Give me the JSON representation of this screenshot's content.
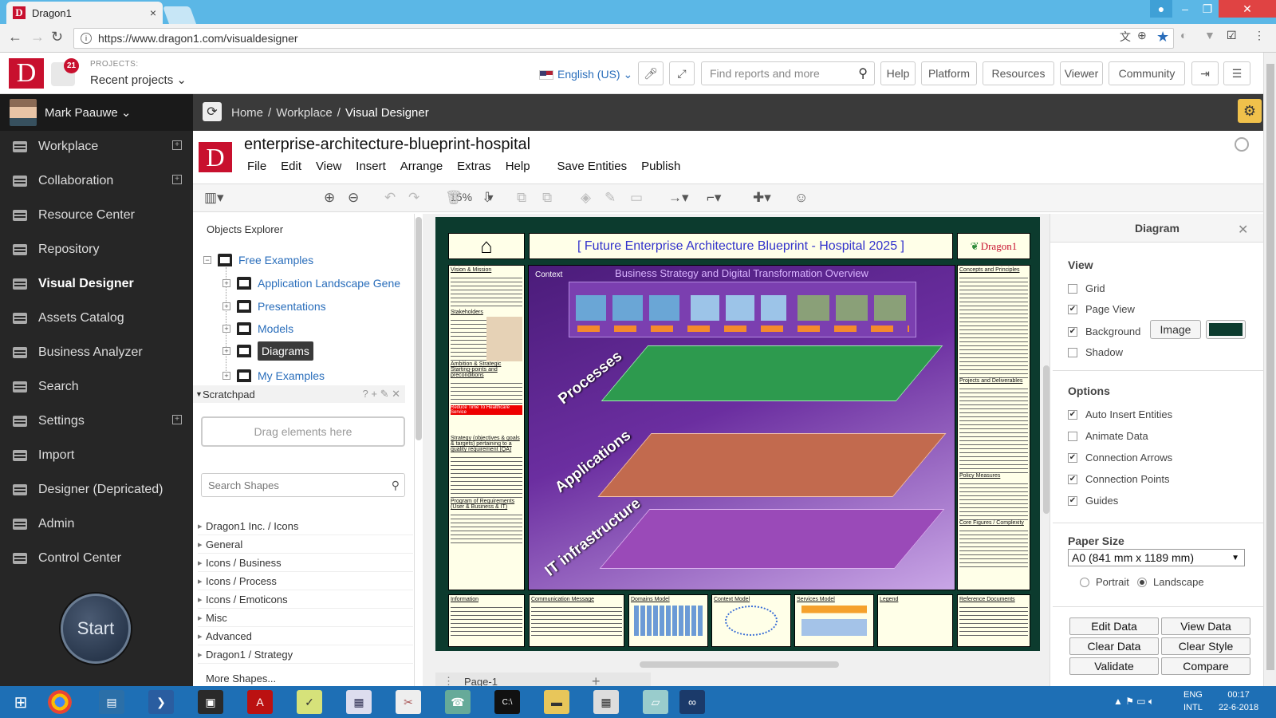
{
  "browser": {
    "tab_title": "Dragon1",
    "tab_close": "×",
    "url": "https://www.dragon1.com/visualdesigner",
    "url_info": "i"
  },
  "header": {
    "logo_letter": "D",
    "notification_count": "21",
    "projects_caption": "PROJECTS:",
    "projects_value": "Recent projects ⌄",
    "language": "English (US) ⌄",
    "search_placeholder": "Find reports and more",
    "buttons": [
      "Help",
      "Platform",
      "Resources",
      "Viewer",
      "Community"
    ]
  },
  "sidebar": {
    "user_name": "Mark Paauwe ⌄",
    "items": [
      {
        "label": "Workplace",
        "icon": "home-icon",
        "expandable": true
      },
      {
        "label": "Collaboration",
        "icon": "sitemap-icon",
        "expandable": true
      },
      {
        "label": "Resource Center",
        "icon": "list-icon",
        "expandable": false
      },
      {
        "label": "Repository",
        "icon": "list-icon",
        "expandable": false
      },
      {
        "label": "Visual Designer",
        "icon": "list-icon",
        "expandable": false,
        "active": true
      },
      {
        "label": "Assets Catalog",
        "icon": "list-icon",
        "expandable": false
      },
      {
        "label": "Business Analyzer",
        "icon": "list-icon",
        "expandable": false
      },
      {
        "label": "Search",
        "icon": "list-icon",
        "expandable": false
      },
      {
        "label": "Settings",
        "icon": "list-icon",
        "expandable": true
      },
      {
        "label": "Import",
        "icon": "list-icon",
        "expandable": false
      },
      {
        "label": "Designer (Depricated)",
        "icon": "list-icon",
        "expandable": false
      },
      {
        "label": "Admin",
        "icon": "list-icon",
        "expandable": false
      },
      {
        "label": "Control Center",
        "icon": "list-icon",
        "expandable": false
      }
    ],
    "start_label": "Start"
  },
  "breadcrumb": {
    "items": [
      "Home",
      "Workplace"
    ],
    "current": "Visual Designer",
    "separator": "/"
  },
  "document": {
    "logo_letter": "D",
    "title": "enterprise-architecture-blueprint-hospital",
    "menu": [
      "File",
      "Edit",
      "View",
      "Insert",
      "Arrange",
      "Extras",
      "Help",
      "Save Entities",
      "Publish"
    ]
  },
  "toolbar": {
    "zoom": "15%"
  },
  "explorer": {
    "title": "Objects Explorer",
    "root": "Free Examples",
    "children": [
      "Application Landscape Gene",
      "Presentations",
      "Models",
      "Diagrams",
      "My Examples"
    ],
    "selected": "Diagrams",
    "scratchpad_title": "Scratchpad",
    "scratchpad_tools": "? + ✎ ✕",
    "drop_hint": "Drag elements here",
    "shape_search_placeholder": "Search Shapes",
    "categories": [
      "Dragon1 Inc. / Icons",
      "General",
      "Icons / Business",
      "Icons / Process",
      "Icons / Emoticons",
      "Misc",
      "Advanced",
      "Dragon1 / Strategy"
    ],
    "more_shapes": "More Shapes..."
  },
  "canvas": {
    "blueprint_title": "[ Future Enterprise Architecture Blueprint - Hospital 2025 ]",
    "brand_label": "Dragon1",
    "subtitle": "Business Strategy and Digital Transformation Overview",
    "context_label": "Context",
    "layers": [
      "Processes",
      "Applications",
      "IT infrastructure"
    ],
    "left_headings": [
      "Vision & Mission",
      "Stakeholders",
      "Ambition & Strategic Starting-points and preconditions",
      "Strategy (objectives & goals & targets) pertaining to a quality requirement (QA)",
      "Program of Requirements (User & Business & IT)"
    ],
    "highlight": "Reduce Time To Healthcare Service",
    "right_headings": [
      "Concepts and Principles",
      "Projects and Deliverables",
      "Policy Measures",
      "Core Figures / Complexity"
    ],
    "bottom_headings": [
      "Information",
      "Communication Message",
      "Domains Model",
      "Context Model",
      "Services Model",
      "Legend",
      "Reference Documents"
    ],
    "page_tab": "Page-1",
    "add_page": "+"
  },
  "right_panel": {
    "title": "Diagram",
    "view_heading": "View",
    "view_options": [
      {
        "label": "Grid",
        "checked": false
      },
      {
        "label": "Page View",
        "checked": true
      },
      {
        "label": "Background",
        "checked": true
      },
      {
        "label": "Shadow",
        "checked": false
      }
    ],
    "image_button": "Image",
    "background_color": "#0c3b2e",
    "options_heading": "Options",
    "options": [
      {
        "label": "Auto Insert Entities",
        "checked": true
      },
      {
        "label": "Animate Data",
        "checked": false
      },
      {
        "label": "Connection Arrows",
        "checked": true
      },
      {
        "label": "Connection Points",
        "checked": true
      },
      {
        "label": "Guides",
        "checked": true
      }
    ],
    "paper_heading": "Paper Size",
    "paper_size": "A0 (841 mm x 1189 mm)",
    "orientation": [
      "Portrait",
      "Landscape"
    ],
    "orientation_selected": "Landscape",
    "buttons": [
      "Edit Data",
      "View Data",
      "Clear Data",
      "Clear Style",
      "Validate",
      "Compare"
    ]
  },
  "taskbar": {
    "lang": "ENG",
    "lang_sub": "INTL",
    "time": "00:17",
    "date": "22-6-2018"
  },
  "colors": {
    "brand_red": "#c8102e",
    "sidebar_bg": "#262626",
    "link_blue": "#2a6ebb",
    "taskbar_blue": "#1e6fb5"
  }
}
